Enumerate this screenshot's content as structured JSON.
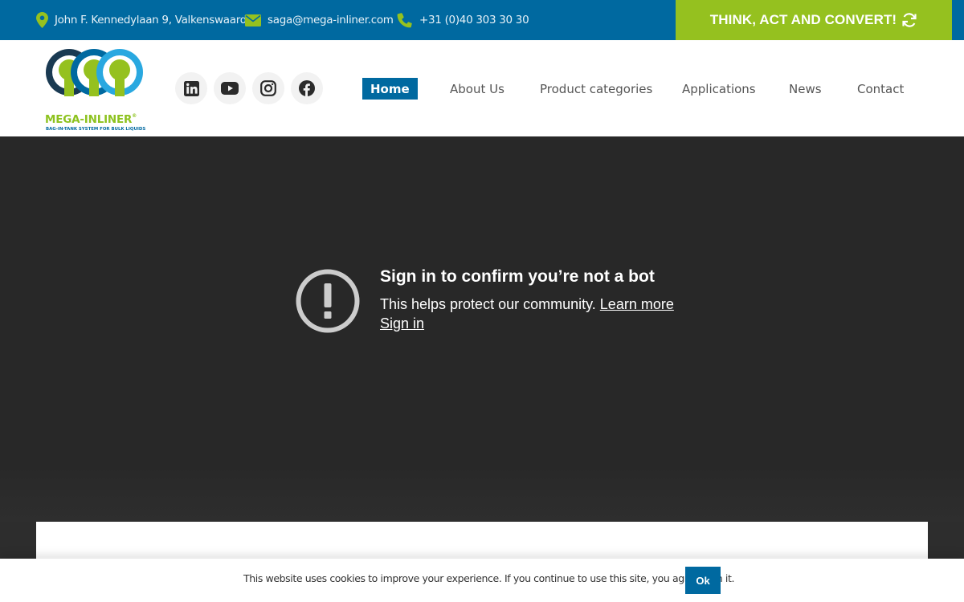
{
  "topbar": {
    "address": "John F. Kennedylaan 9, Valkenswaard",
    "email": "saga@mega-inliner.com",
    "phone": "+31 (0)40 303 30 30",
    "cta_label": "THINK, ACT AND CONVERT!"
  },
  "brand": {
    "name": "MEGA-INLINER",
    "tagline": "BAG-IN-TANK SYSTEM FOR BULK LIQUIDS",
    "green": "#95c11f",
    "blue": "#0069a0"
  },
  "social": [
    {
      "icon": "linkedin-icon"
    },
    {
      "icon": "youtube-icon"
    },
    {
      "icon": "instagram-icon"
    },
    {
      "icon": "facebook-icon"
    }
  ],
  "nav": {
    "home": "Home",
    "about": "About Us",
    "products": "Product categories",
    "applications": "Applications",
    "news": "News",
    "contact": "Contact"
  },
  "video": {
    "title": "Sign in to confirm you’re not a bot",
    "message": "This helps protect our community.",
    "learn_more": "Learn more",
    "sign_in": "Sign in"
  },
  "cookie": {
    "text": "This website uses cookies to improve your experience. If you continue to use this site, you agree with it.",
    "ok": "Ok"
  }
}
